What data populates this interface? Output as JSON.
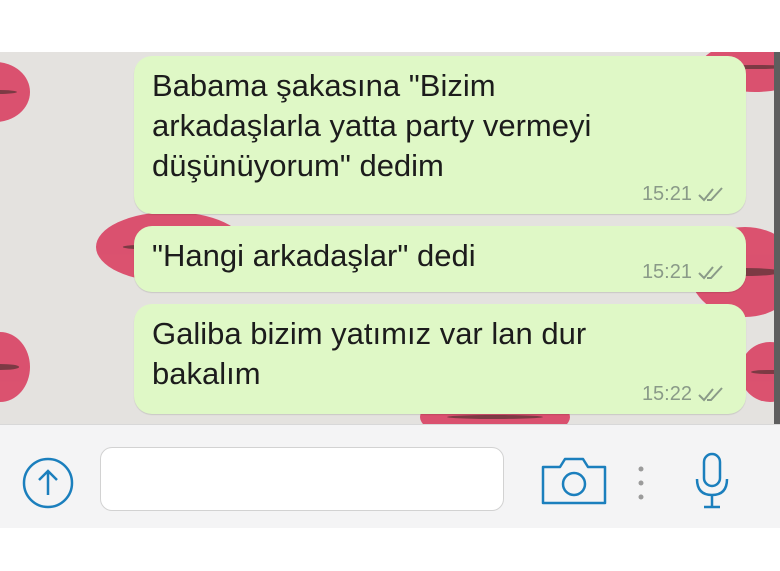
{
  "colors": {
    "bubble_outgoing": "#dff8c6",
    "accent_blue": "#1b7fbd",
    "wallpaper_lips": "#d9385c"
  },
  "messages": [
    {
      "text": "Babama şakasına \"Bizim\narkadaşlarla yatta party vermeyi\ndüşünüyorum\" dedim",
      "time": "15:21",
      "status_icon": "double-check-icon"
    },
    {
      "text": "\"Hangi arkadaşlar\" dedi",
      "time": "15:21",
      "status_icon": "double-check-icon"
    },
    {
      "text": "Galiba bizim yatımız var lan dur\nbakalım",
      "time": "15:22",
      "status_icon": "double-check-icon"
    }
  ],
  "input_bar": {
    "message_value": "",
    "attach_icon": "arrow-up-circle-icon",
    "camera_icon": "camera-icon",
    "more_icon": "vertical-dots-icon",
    "mic_icon": "microphone-icon"
  }
}
